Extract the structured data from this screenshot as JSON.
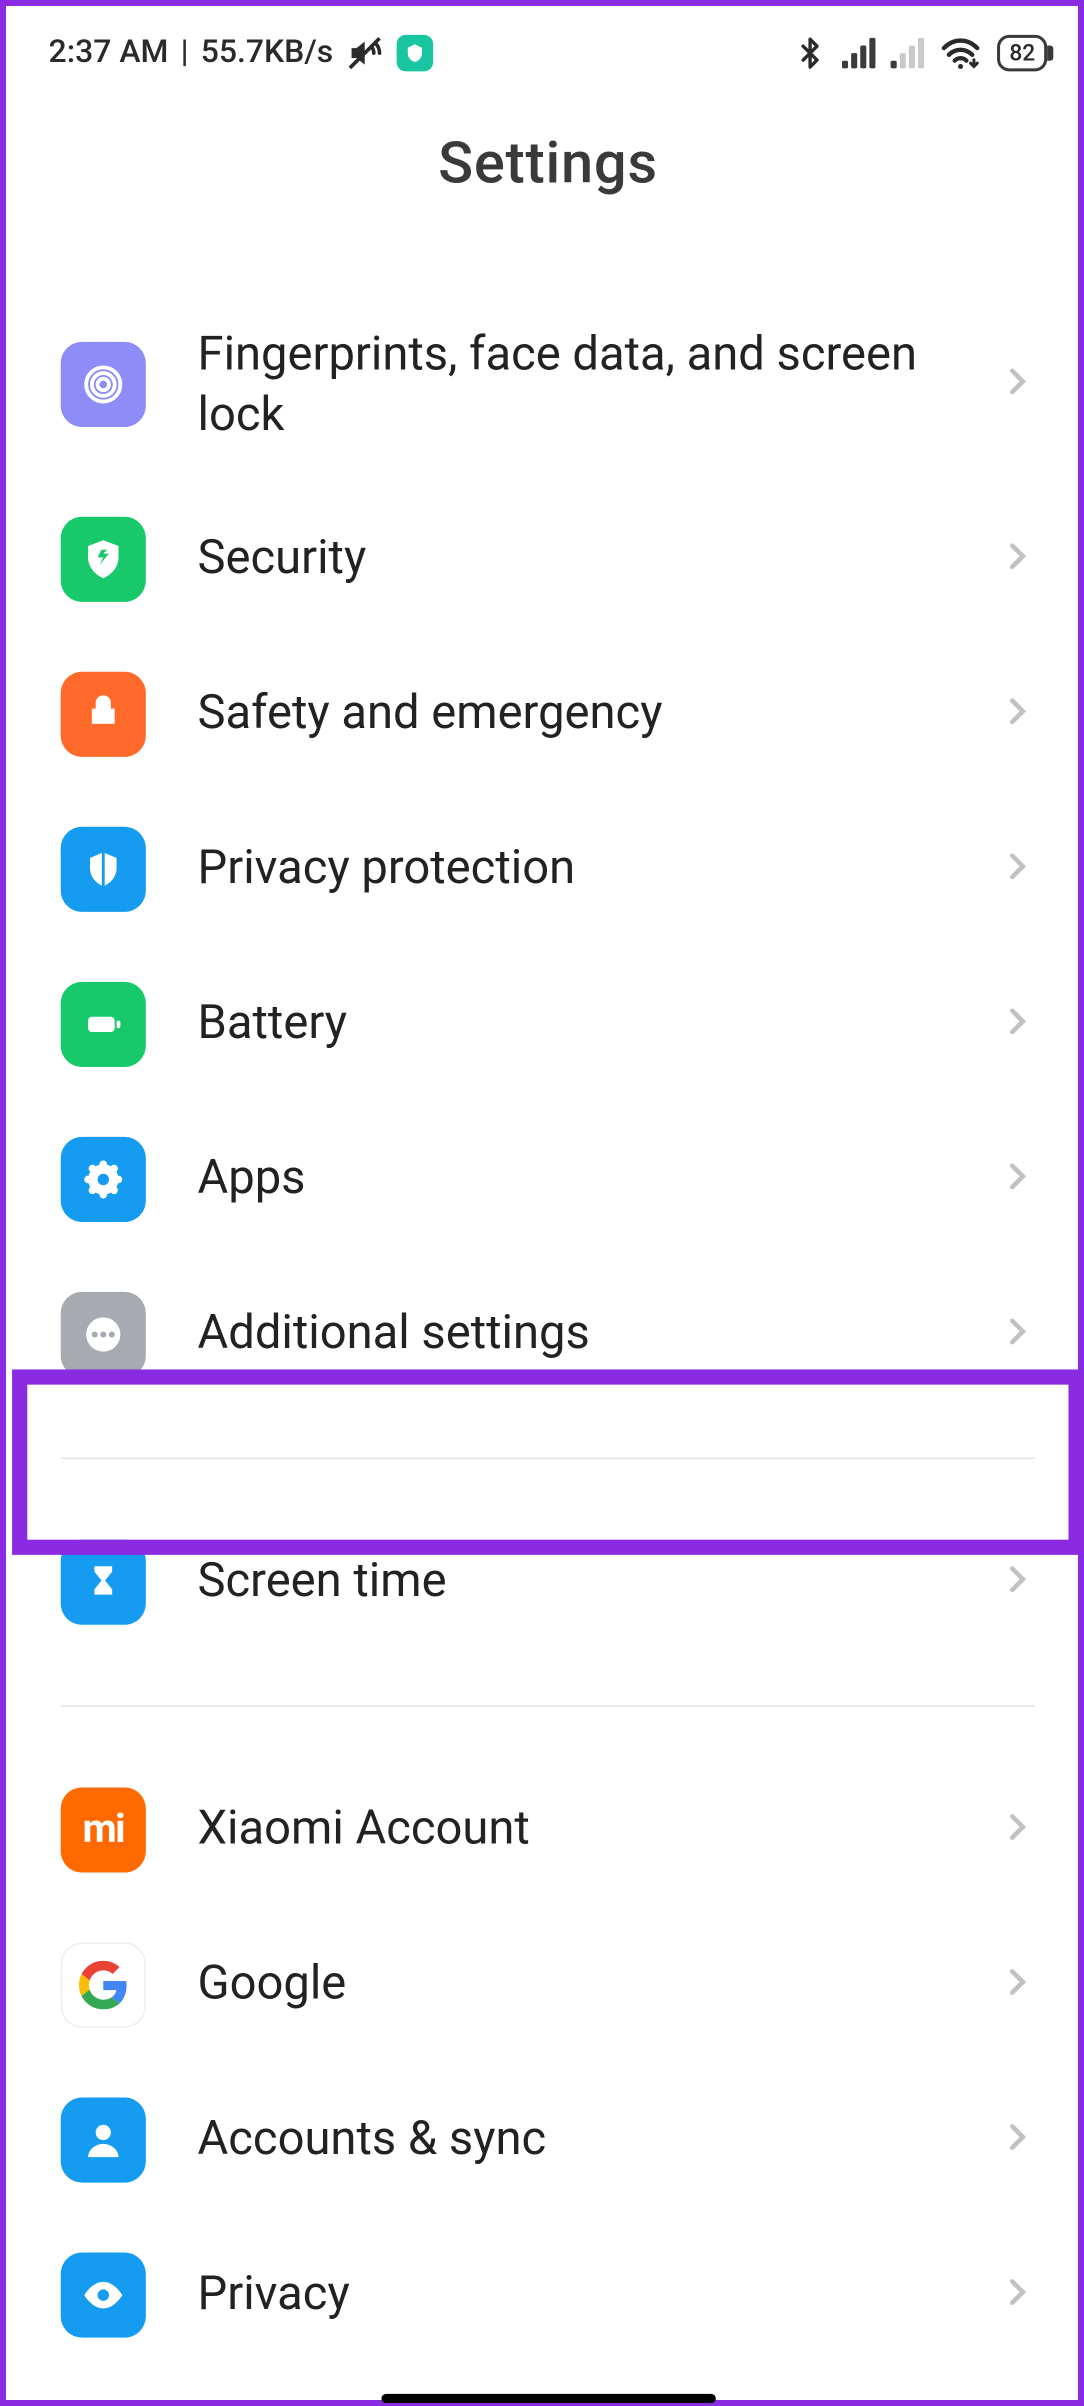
{
  "status": {
    "time": "2:37 AM",
    "speed": "55.7KB/s",
    "battery": "82"
  },
  "title": "Settings",
  "rows": {
    "fingerprints": "Fingerprints, face data, and screen lock",
    "security": "Security",
    "safety": "Safety and emergency",
    "privacyprot": "Privacy protection",
    "battery": "Battery",
    "apps": "Apps",
    "additional": "Additional settings",
    "screentime": "Screen time",
    "xiaomi": "Xiaomi Account",
    "google": "Google",
    "accounts": "Accounts & sync",
    "privacy": "Privacy"
  },
  "highlighted_row": "apps"
}
